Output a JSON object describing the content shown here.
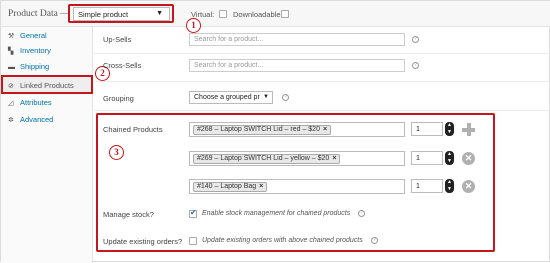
{
  "header": {
    "title": "Product Data —",
    "product_type": "Simple product",
    "virtual_label": "Virtual:",
    "downloadable_label": "Downloadable:"
  },
  "callouts": [
    "1",
    "2",
    "3"
  ],
  "sidebar": {
    "items": [
      {
        "label": "General",
        "icon": "wrench-icon"
      },
      {
        "label": "Inventory",
        "icon": "inventory-icon"
      },
      {
        "label": "Shipping",
        "icon": "truck-icon"
      },
      {
        "label": "Linked Products",
        "icon": "link-icon"
      },
      {
        "label": "Attributes",
        "icon": "attributes-icon"
      },
      {
        "label": "Advanced",
        "icon": "gear-icon"
      }
    ]
  },
  "fields": {
    "upsells_label": "Up-Sells",
    "upsells_placeholder": "Search for a product...",
    "crosssells_label": "Cross-Sells",
    "crosssells_placeholder": "Search for a product...",
    "grouping_label": "Grouping",
    "grouping_value": "Choose a grouped pr"
  },
  "chained": {
    "label": "Chained Products",
    "rows": [
      {
        "token": "#268 – Laptop SWITCH Lid – red – $20",
        "qty": "1"
      },
      {
        "token": "#269 – Laptop SWITCH Lid – yellow – $20",
        "qty": "1"
      },
      {
        "token": "#140 – Laptop Bag",
        "qty": "1"
      }
    ],
    "manage_label": "Manage stock?",
    "manage_desc": "Enable stock management for chained products",
    "update_label": "Update existing orders?",
    "update_desc": "Update existing orders with above chained products"
  },
  "colors": {
    "accent": "#c4161c",
    "link": "#0073aa"
  }
}
